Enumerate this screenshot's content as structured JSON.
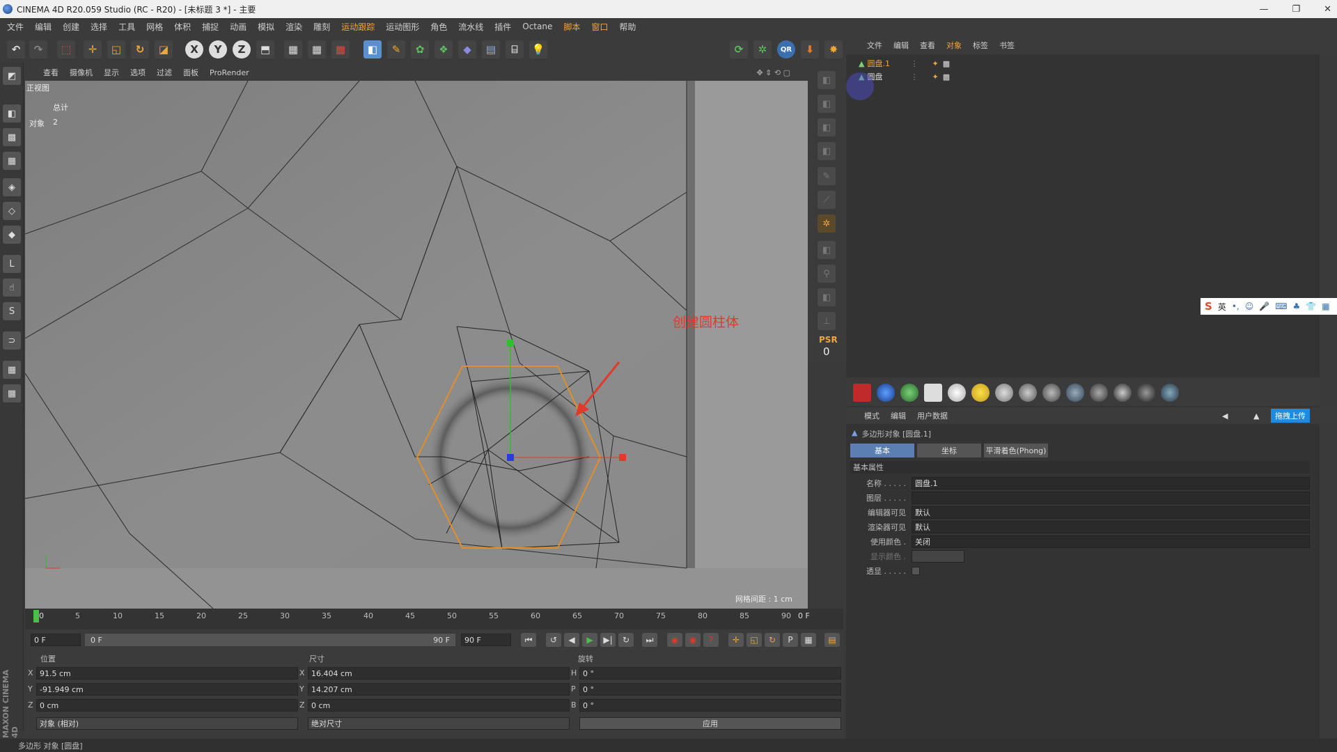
{
  "window": {
    "title": "CINEMA 4D R20.059 Studio (RC - R20) - [未标题 3 *] - 主要",
    "controls": [
      "—",
      "❐",
      "✕"
    ]
  },
  "menu": [
    "文件",
    "编辑",
    "创建",
    "选择",
    "工具",
    "网格",
    "体积",
    "捕捉",
    "动画",
    "模拟",
    "渲染",
    "雕刻",
    "运动跟踪",
    "运动图形",
    "角色",
    "流水线",
    "插件",
    "Octane",
    "脚本",
    "窗口",
    "帮助"
  ],
  "viewport": {
    "menu": [
      "查看",
      "摄像机",
      "显示",
      "选项",
      "过滤",
      "面板",
      "ProRender"
    ],
    "view_name": "正视图",
    "hud": {
      "total_label": "总计",
      "objects_label": "对象",
      "objects_count": "2"
    },
    "grid_spacing": "网格间距 : 1 cm",
    "annotation": "创建圆柱体",
    "psr_label": "PSR",
    "psr_value": "0"
  },
  "object_manager": {
    "menu": [
      "文件",
      "编辑",
      "查看",
      "对象",
      "标签",
      "书签"
    ],
    "objects": [
      {
        "name": "圆盘.1"
      },
      {
        "name": "圆盘"
      }
    ]
  },
  "attributes": {
    "menu": [
      "模式",
      "编辑",
      "用户数据"
    ],
    "header": "多边形对象 [圆盘.1]",
    "upload_button": "拖拽上传",
    "tabs": [
      "基本",
      "坐标",
      "平滑着色(Phong)"
    ],
    "section": "基本属性",
    "fields": [
      {
        "label": "名称 . . . . .",
        "value": "圆盘.1"
      },
      {
        "label": "图层 . . . . .",
        "value": ""
      },
      {
        "label": "编辑器可见",
        "value": "默认"
      },
      {
        "label": "渲染器可见",
        "value": "默认"
      },
      {
        "label": "使用颜色 .",
        "value": "关闭"
      },
      {
        "label": "显示颜色 .",
        "value": ""
      },
      {
        "label": "透显 . . . . .",
        "value": ""
      }
    ]
  },
  "timeline": {
    "ticks": [
      "0",
      "5",
      "10",
      "15",
      "20",
      "25",
      "30",
      "35",
      "40",
      "45",
      "50",
      "55",
      "60",
      "65",
      "70",
      "75",
      "80",
      "85",
      "90"
    ],
    "current_frame": "0 F",
    "start_frame": "0 F",
    "range_start": "0 F",
    "range_end": "90 F",
    "end_frame": "90 F"
  },
  "coordinates": {
    "headers": {
      "position": "位置",
      "size": "尺寸",
      "rotation": "旋转"
    },
    "position": [
      {
        "axis": "X",
        "value": "91.5 cm"
      },
      {
        "axis": "Y",
        "value": "-91.949 cm"
      },
      {
        "axis": "Z",
        "value": "0 cm"
      }
    ],
    "size": [
      {
        "axis": "X",
        "value": "16.404 cm"
      },
      {
        "axis": "Y",
        "value": "14.207 cm"
      },
      {
        "axis": "Z",
        "value": "0 cm"
      }
    ],
    "rotation": [
      {
        "axis": "H",
        "value": "0 °"
      },
      {
        "axis": "P",
        "value": "0 °"
      },
      {
        "axis": "B",
        "value": "0 °"
      }
    ],
    "mode_object": "对象 (相对)",
    "mode_size": "绝对尺寸",
    "apply": "应用"
  },
  "brand": "MAXON CINEMA 4D",
  "status": "多边形 对象 [圆盘]",
  "ime": {
    "label": "英"
  },
  "colors": {
    "accent_orange": "#f2a63a",
    "tab_active": "#5a7fb0",
    "selection_orange": "#e0902a",
    "annotation_red": "#e03a2a"
  }
}
